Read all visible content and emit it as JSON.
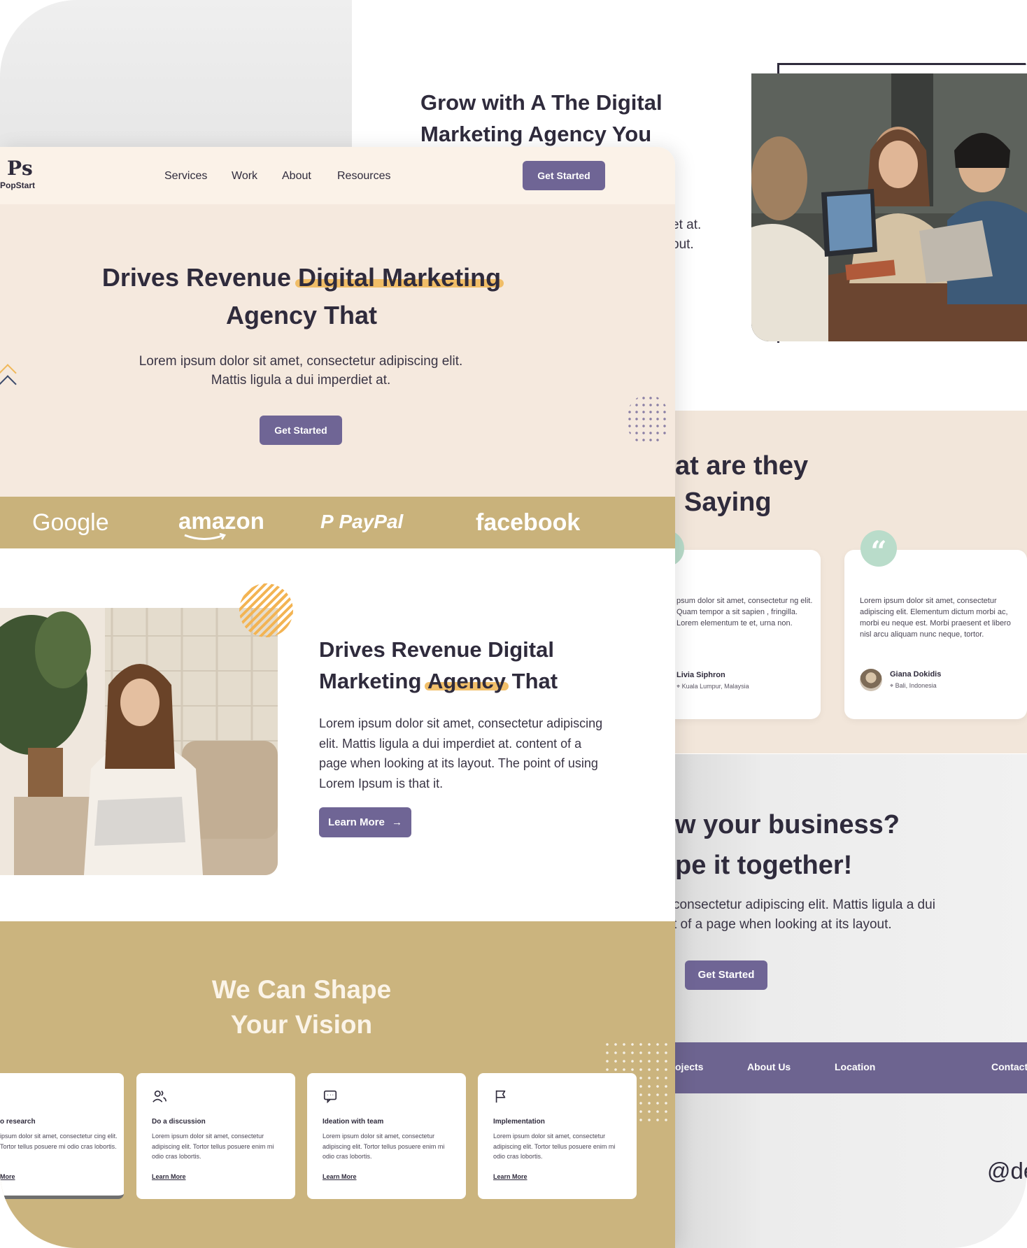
{
  "brand": {
    "mark": "Ps",
    "name": "PopStart"
  },
  "nav": {
    "items": [
      "Services",
      "Work",
      "About",
      "Resources"
    ],
    "cta": "Get Started"
  },
  "hero": {
    "title_part1": "Drives Revenue ",
    "title_highlight": "Digital Marketing",
    "title_part2": "Agency That",
    "text": "Lorem ipsum dolor sit amet, consectetur adipiscing elit. Mattis ligula a dui imperdiet at.",
    "cta": "Get Started"
  },
  "brands": [
    "Google",
    "amazon",
    "PayPal",
    "facebook"
  ],
  "about": {
    "title_part1": "Drives Revenue Digital Marketing ",
    "title_highlight": "Agency",
    "title_part2": " That",
    "text": "Lorem ipsum dolor sit amet, consectetur adipiscing elit. Mattis ligula a dui imperdiet at. content of a page when looking at its layout. The point of using Lorem Ipsum is that it.",
    "cta": "Learn More"
  },
  "vision": {
    "title_line1": "We Can Shape",
    "title_line2": "Your Vision",
    "cards": [
      {
        "title": "o research",
        "text": "ipsum dolor sit amet, consectetur cing elit. Tortor tellus posuere mi odio cras lobortis.",
        "link": "More",
        "icon": "search-icon"
      },
      {
        "title": "Do a discussion",
        "text": "Lorem ipsum dolor sit amet, consectetur adipiscing elit. Tortor tellus posuere enim mi odio cras lobortis.",
        "link": "Learn More",
        "icon": "users-icon"
      },
      {
        "title": "Ideation with team",
        "text": "Lorem ipsum dolor sit amet, consectetur adipiscing elit. Tortor tellus posuere enim mi odio cras lobortis.",
        "link": "Learn More",
        "icon": "chat-icon"
      },
      {
        "title": "Implementation",
        "text": "Lorem ipsum dolor sit amet, consectetur adipiscing elit. Tortor tellus posuere enim mi odio cras lobortis.",
        "link": "Learn More",
        "icon": "flag-icon"
      }
    ]
  },
  "back": {
    "hero_title_line1": "Grow with A The Digital",
    "hero_title_line2": "Marketing Agency You",
    "hero_frag_line1": "et at.",
    "hero_frag_line2": "out.",
    "testimonials_heading_line1": "at are they",
    "testimonials_heading_line2": "Saying",
    "testimonials": [
      {
        "text": "psum dolor sit amet, consectetur ng elit. Quam tempor a sit sapien , fringilla. Lorem elementum te et, urna non.",
        "author": "Livia Siphron",
        "location": "Kuala Lumpur, Malaysia"
      },
      {
        "text": "Lorem ipsum dolor sit amet, consectetur adipiscing elit. Elementum dictum morbi ac, morbi eu neque est. Morbi praesent et libero nisl arcu aliquam nunc neque, tortor.",
        "author": "Giana Dokidis",
        "location": "Bali, Indonesia"
      }
    ],
    "cta_title_line1": "w your business?",
    "cta_title_line2": "pe it together!",
    "cta_text_line1": "consectetur adipiscing elit. Mattis ligula a dui",
    "cta_text_line2": "t of a page when looking at its layout.",
    "cta_button": "Get Started",
    "footer_links": [
      "ojects",
      "About Us",
      "Location",
      "Contact"
    ],
    "handle": "@de"
  },
  "colors": {
    "accent": "#6f6595",
    "gold": "#c9b27b",
    "cream": "#f5e9de",
    "highlight": "#f0b85a",
    "mint": "#b9dcca"
  }
}
